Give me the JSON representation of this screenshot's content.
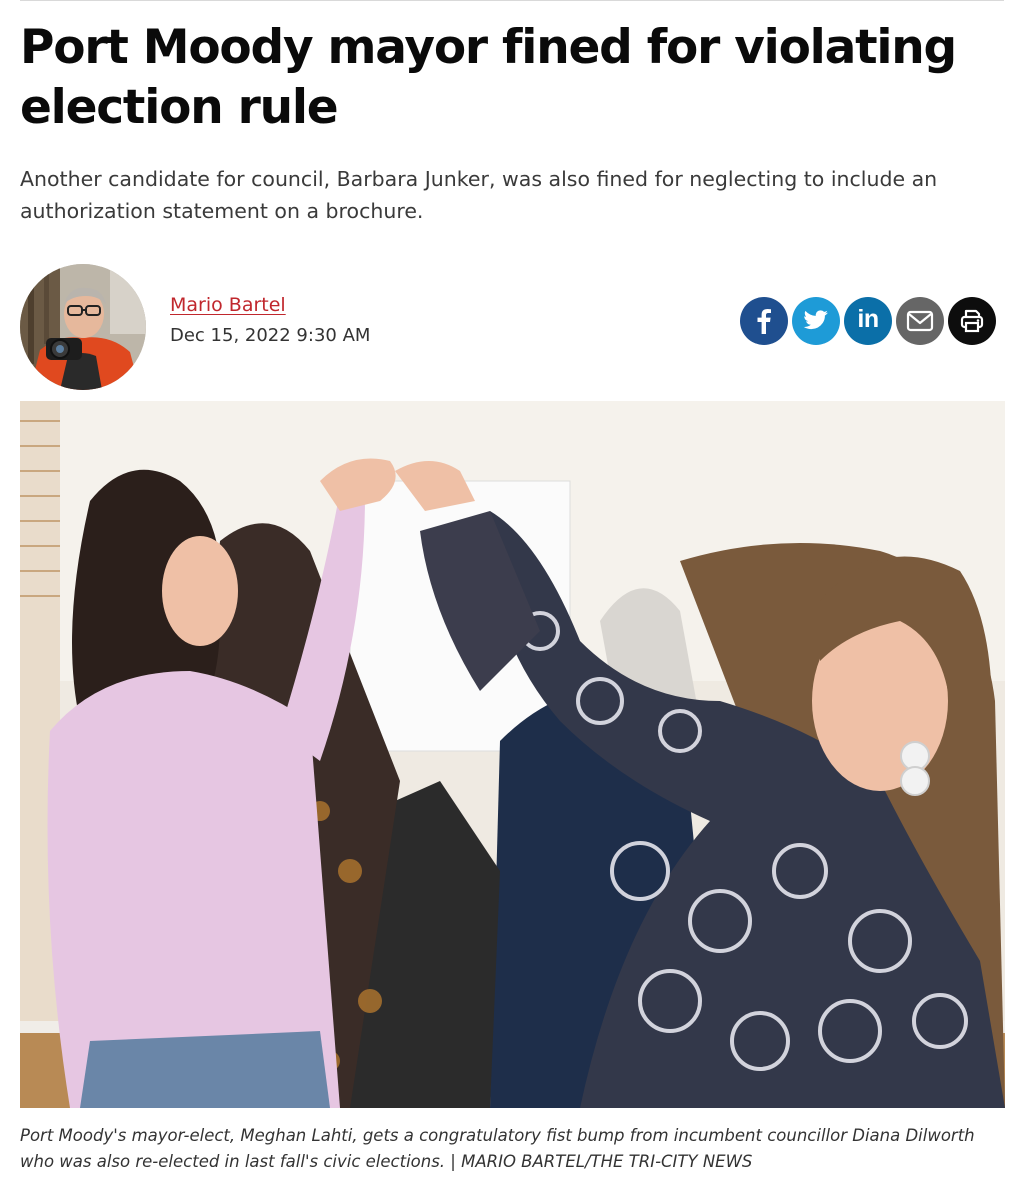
{
  "article": {
    "headline": "Port Moody mayor fined for violating election rule",
    "dek": "Another candidate for council, Barbara Junker, was also fined for neglecting to include an authorization statement on a brochure."
  },
  "byline": {
    "author": "Mario Bartel",
    "date": "Dec 15, 2022 9:30 AM"
  },
  "share": {
    "icons": [
      "facebook-icon",
      "twitter-icon",
      "linkedin-icon",
      "email-icon",
      "print-icon"
    ],
    "colors": {
      "facebook": "#1f4f8f",
      "twitter": "#1e9bd7",
      "linkedin": "#0b6fa8",
      "email": "#666666",
      "print": "#0d0d0d"
    },
    "linkedin_text": "in"
  },
  "photo": {
    "caption": "Port Moody's mayor-elect, Meghan Lahti, gets a congratulatory fist bump from incumbent councillor Diana Dilworth who was also re-elected in last fall's civic elections.  |  MARIO BARTEL/THE TRI-CITY NEWS"
  },
  "theme": {
    "author_link_color": "#c0272d",
    "headline_color": "#0a0a0a"
  }
}
